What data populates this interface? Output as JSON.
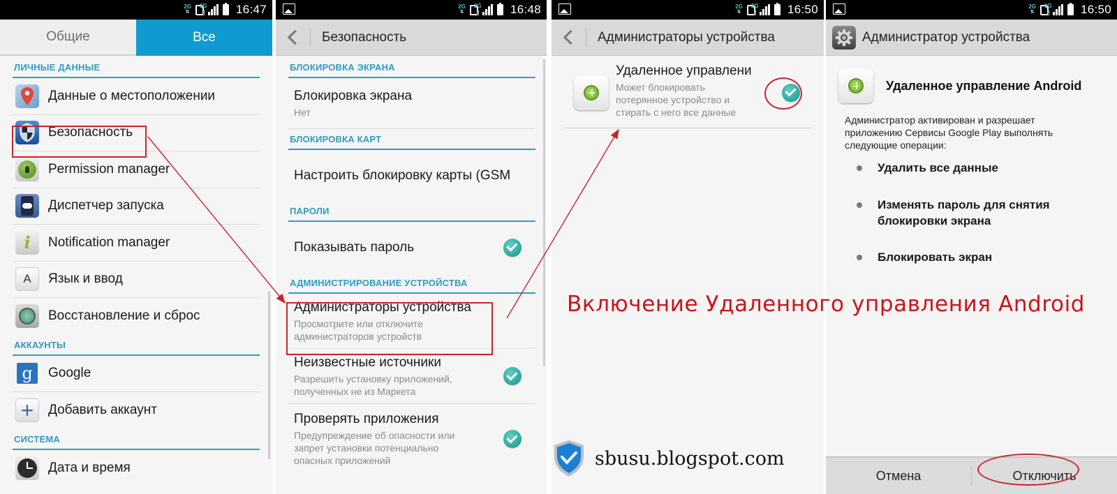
{
  "colors": {
    "accent": "#0f9bd1",
    "section_header": "#2e9dbd",
    "annotation_red": "#cc1419",
    "check_teal": "#2aa69b"
  },
  "screens": [
    {
      "status_time": "16:47",
      "tabs": [
        {
          "label": "Общие",
          "active": false
        },
        {
          "label": "Все",
          "active": true
        }
      ],
      "sections": [
        {
          "header": "ЛИЧНЫЕ ДАННЫЕ",
          "items": [
            {
              "label": "Данные о местоположении",
              "icon": "location-icon"
            },
            {
              "label": "Безопасность",
              "icon": "shield-icon",
              "highlighted": true
            },
            {
              "label": "Permission manager",
              "icon": "lock-icon"
            },
            {
              "label": "Диспетчер запуска",
              "icon": "phone-toggle-icon"
            },
            {
              "label": "Notification manager",
              "icon": "info-icon"
            },
            {
              "label": "Язык и ввод",
              "icon": "keyboard-icon"
            },
            {
              "label": "Восстановление и сброс",
              "icon": "backup-icon"
            }
          ]
        },
        {
          "header": "АККАУНТЫ",
          "items": [
            {
              "label": "Google",
              "icon": "google-icon"
            },
            {
              "label": "Добавить аккаунт",
              "icon": "plus-icon"
            }
          ]
        },
        {
          "header": "СИСТЕМА",
          "items": [
            {
              "label": "Дата и время",
              "icon": "clock-icon"
            }
          ]
        }
      ]
    },
    {
      "status_time": "16:48",
      "title": "Безопасность",
      "sections": [
        {
          "header": "БЛОКИРОВКА ЭКРАНА",
          "items": [
            {
              "title": "Блокировка экрана",
              "subtitle": "Нет"
            }
          ]
        },
        {
          "header": "БЛОКИРОВКА КАРТ",
          "items": [
            {
              "title": "Настроить блокировку карты (GSM"
            }
          ]
        },
        {
          "header": "ПАРОЛИ",
          "items": [
            {
              "title": "Показывать пароль",
              "checked": true
            }
          ]
        },
        {
          "header": "АДМИНИСТРИРОВАНИЕ УСТРОЙСТВА",
          "items": [
            {
              "title": "Администраторы устройства",
              "subtitle_lines": [
                "Просмотрите или отключите",
                "администраторов устройств"
              ],
              "highlighted": true
            },
            {
              "title": "Неизвестные источники",
              "subtitle_lines": [
                "Разрешить установку приложений,",
                "полученных не из Маркета"
              ],
              "checked": true
            },
            {
              "title": "Проверять приложения",
              "subtitle_lines": [
                "Предупреждение об опасности или",
                "запрет установки потенциально",
                "опасных приложений"
              ],
              "checked": true
            }
          ]
        }
      ]
    },
    {
      "status_time": "16:50",
      "title": "Администраторы устройства",
      "items": [
        {
          "title": "Удаленное управлени",
          "subtitle_lines": [
            "Может блокировать",
            "потерянное устройство и",
            "стирать с него все данные"
          ],
          "checked": true
        }
      ]
    },
    {
      "status_time": "16:50",
      "title": "Администратор устройства",
      "app_name": "Удаленное управление Android",
      "description_lines": [
        "Администратор активирован и разрешает",
        "приложению Сервисы Google Play выполнять",
        "следующие операции:"
      ],
      "permissions": [
        [
          "Удалить все данные"
        ],
        [
          "Изменять пароль для снятия",
          "блокировки экрана"
        ],
        [
          "Блокировать экран"
        ]
      ],
      "buttons": {
        "cancel": "Отмена",
        "disable": "Отключить"
      }
    }
  ],
  "annotation": {
    "caption": "Включение Удаленного управления Android",
    "brand": "sbusu.blogspot.com"
  }
}
